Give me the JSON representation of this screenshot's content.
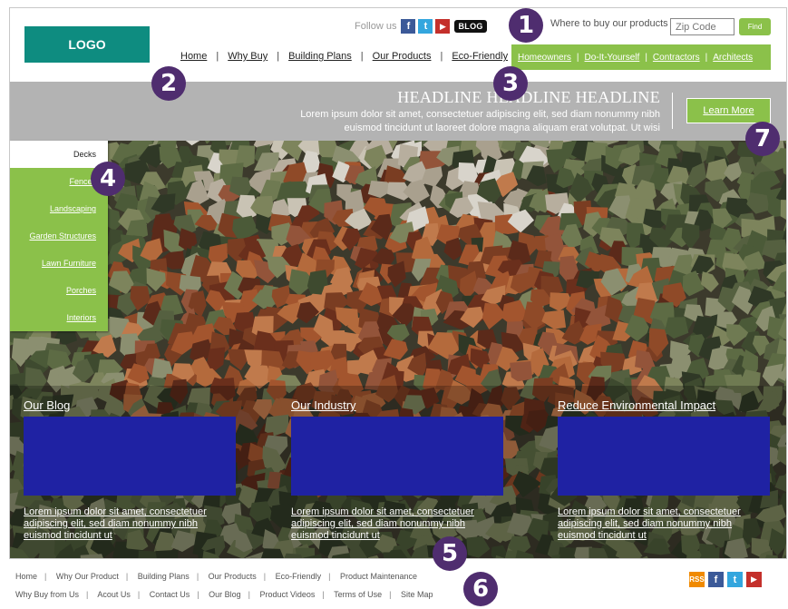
{
  "header": {
    "logo": "LOGO",
    "follow_label": "Follow us",
    "blog_label": "BLOG",
    "where_label": "Where to buy our products",
    "zip_placeholder": "Zip Code",
    "find_label": "Find"
  },
  "main_nav": [
    "Home",
    "Why Buy",
    "Building Plans",
    "Our Products",
    "Eco-Friendly"
  ],
  "audience_nav": [
    "Homeowners",
    "Do-It-Yourself",
    "Contractors",
    "Architects"
  ],
  "headline": {
    "title": "HEADLINE HEADLINE HEADLINE",
    "body": "Lorem ipsum dolor sit amet, consectetuer adipiscing elit, sed diam nonummy nibh euismod tincidunt ut laoreet dolore magna aliquam erat volutpat. Ut wisi",
    "cta": "Learn More"
  },
  "side_nav": [
    "Decks",
    "Fences",
    "Landscaping",
    "Garden Structures",
    "Lawn Furniture",
    "Porches",
    "Interiors"
  ],
  "columns": [
    {
      "title": "Our Blog",
      "body": "Lorem ipsum dolor sit amet, consectetuer adipiscing elit, sed diam nonummy nibh euismod tincidunt ut"
    },
    {
      "title": "Our Industry",
      "body": "Lorem ipsum dolor sit amet, consectetuer adipiscing elit, sed diam nonummy nibh euismod tincidunt ut"
    },
    {
      "title": "Reduce Environmental Impact",
      "body": "Lorem ipsum dolor sit amet, consectetuer adipiscing elit, sed diam nonummy nibh euismod tincidunt ut"
    }
  ],
  "footer_row1": [
    "Home",
    "Why Our Product",
    "Building Plans",
    "Our Products",
    "Eco-Friendly",
    "Product Maintenance"
  ],
  "footer_row2": [
    "Why Buy from Us",
    "Acout Us",
    "Contact Us",
    "Our Blog",
    "Product Videos",
    "Terms of Use",
    "Site Map"
  ],
  "callouts": [
    "1",
    "2",
    "3",
    "4",
    "5",
    "6",
    "7"
  ],
  "colors": {
    "logo_bg": "#0e8c80",
    "accent_green": "#8bc14a",
    "band_gray": "#b3b3b3",
    "image_placeholder": "#1f22a3",
    "callout": "#4f2d6f"
  }
}
